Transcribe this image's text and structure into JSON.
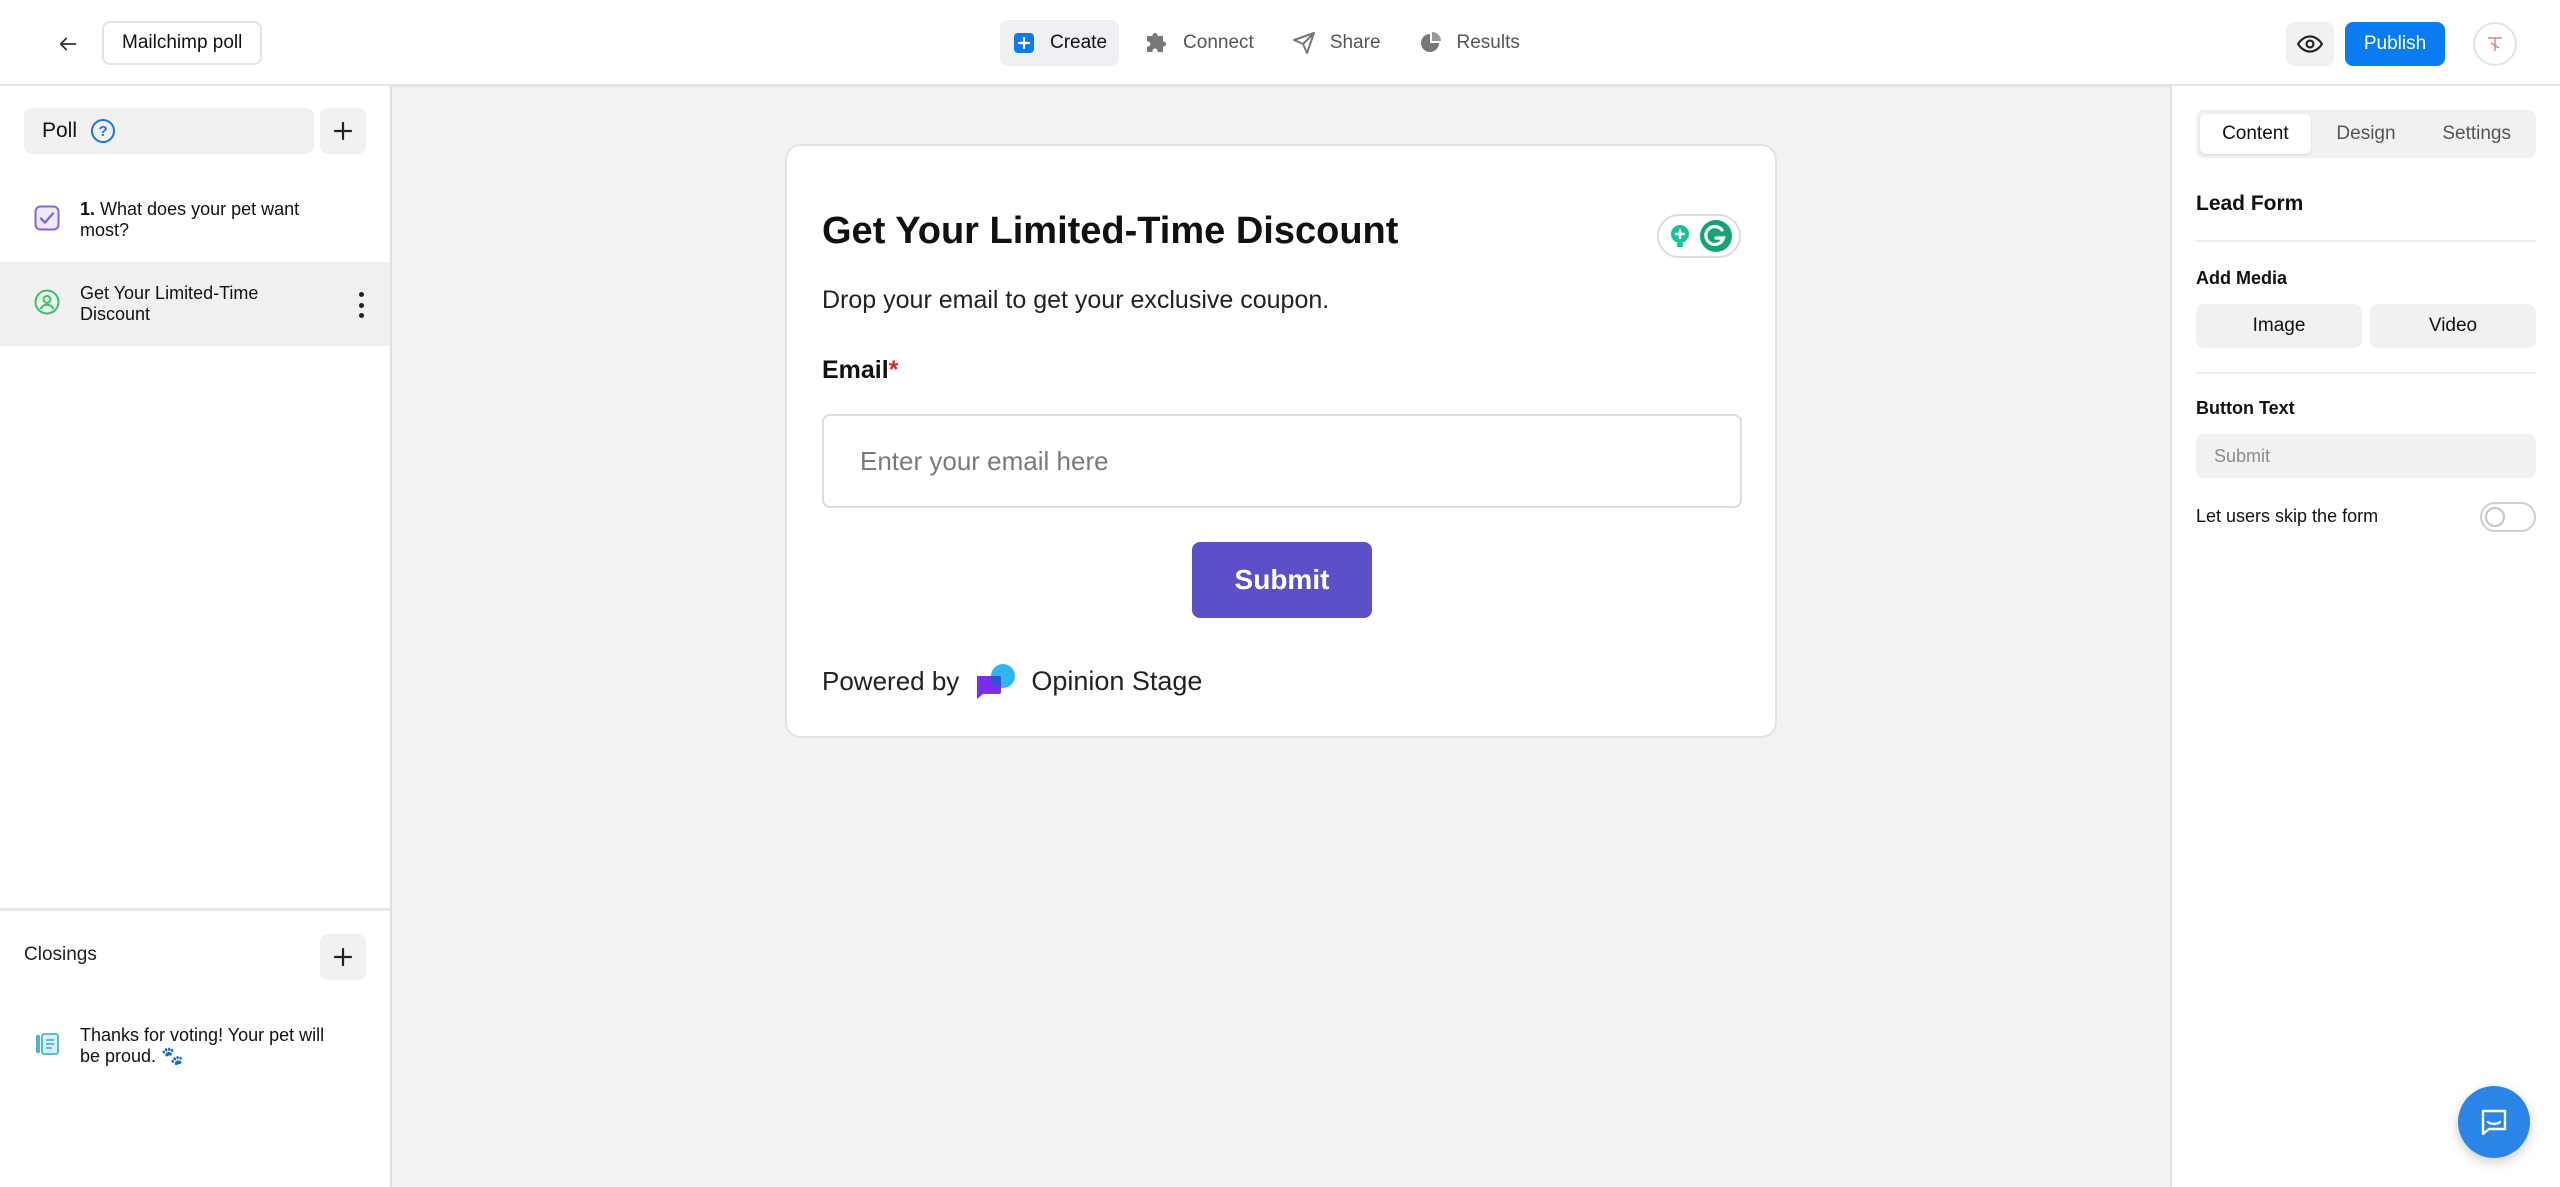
{
  "header": {
    "poll_title": "Mailchimp poll",
    "nav": [
      {
        "label": "Create",
        "icon": "plus-square-icon",
        "active": true
      },
      {
        "label": "Connect",
        "icon": "puzzle-icon",
        "active": false
      },
      {
        "label": "Share",
        "icon": "send-icon",
        "active": false
      },
      {
        "label": "Results",
        "icon": "pie-chart-icon",
        "active": false
      }
    ],
    "publish_label": "Publish",
    "accent_color": "#0a7cf2"
  },
  "sidebar": {
    "section_label": "Poll",
    "items": [
      {
        "number": "1.",
        "text": "What does your pet want most?",
        "icon": "checkbox-icon"
      },
      {
        "text": "Get Your Limited-Time Discount",
        "icon": "lead-form-icon"
      }
    ],
    "closings_label": "Closings",
    "closings": [
      {
        "text": "Thanks for voting! Your pet will be proud. 🐾",
        "icon": "closing-page-icon"
      }
    ]
  },
  "card": {
    "title": "Get Your Limited-Time Discount",
    "subtitle": "Drop your email to get your exclusive coupon.",
    "email_label": "Email",
    "required_mark": "*",
    "email_placeholder": "Enter your email here",
    "submit_label": "Submit",
    "powered_by": "Powered by",
    "brand": "Opinion Stage",
    "submit_color": "#5b50c7"
  },
  "panel": {
    "tabs": [
      {
        "label": "Content",
        "active": true
      },
      {
        "label": "Design",
        "active": false
      },
      {
        "label": "Settings",
        "active": false
      }
    ],
    "title": "Lead Form",
    "add_media_label": "Add Media",
    "image_label": "Image",
    "video_label": "Video",
    "button_text_label": "Button Text",
    "button_text_placeholder": "Submit",
    "skip_label": "Let users skip the form",
    "skip_enabled": false
  }
}
